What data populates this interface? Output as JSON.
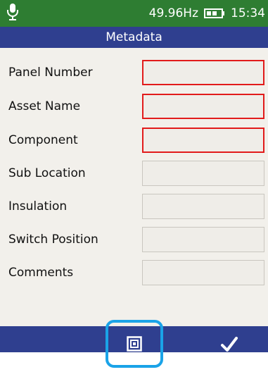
{
  "status_bar": {
    "frequency": "49.96Hz",
    "time": "15:34",
    "icons": [
      "microphone-icon",
      "battery-icon"
    ]
  },
  "title_bar": {
    "title": "Metadata"
  },
  "form": {
    "fields": [
      {
        "label": "Panel Number",
        "value": "",
        "required": true
      },
      {
        "label": "Asset Name",
        "value": "",
        "required": true
      },
      {
        "label": "Component",
        "value": "",
        "required": true
      },
      {
        "label": "Sub Location",
        "value": "",
        "required": false
      },
      {
        "label": "Insulation",
        "value": "",
        "required": false
      },
      {
        "label": "Switch Position",
        "value": "",
        "required": false
      },
      {
        "label": "Comments",
        "value": "",
        "required": false
      }
    ]
  },
  "bottom_bar": {
    "icons": [
      "nfc-icon",
      "checkmark-icon"
    ]
  },
  "colors": {
    "status_bar": "#2e7d32",
    "title_bar": "#2f3f8f",
    "background": "#f2f0eb",
    "required_border": "#e21b1b",
    "highlight": "#1aa3e8"
  }
}
